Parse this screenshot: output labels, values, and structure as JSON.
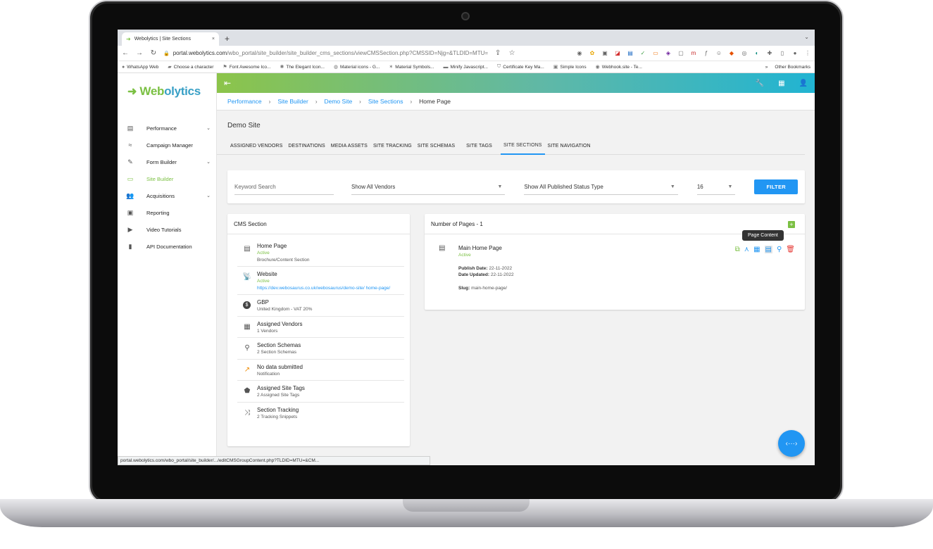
{
  "browser": {
    "tab_title": "Webolytics | Site Sections",
    "tab_close": "×",
    "new_tab": "+",
    "tab_menu": "⌄",
    "url_domain": "portal.webolytics.com",
    "url_path": "/wbo_portal/site_builder/site_builder_cms_sections/viewCMSSection.php?CMSSID=Njg=&TLDID=MTU=",
    "bookmarks": [
      {
        "icon": "whatsapp-icon",
        "label": "WhatsApp Web"
      },
      {
        "icon": "character-icon",
        "label": "Choose a character"
      },
      {
        "icon": "flag-icon",
        "label": "Font Awesome Ico..."
      },
      {
        "icon": "elegant-icon",
        "label": "The Elegant Icon..."
      },
      {
        "icon": "material-icon",
        "label": "Material icons - G..."
      },
      {
        "icon": "symbols-icon",
        "label": "Material Symbols..."
      },
      {
        "icon": "minify-icon",
        "label": "Minify Javascript..."
      },
      {
        "icon": "certificate-icon",
        "label": "Certificate Key Ma..."
      },
      {
        "icon": "simple-icon",
        "label": "Simple Icons"
      },
      {
        "icon": "webhook-icon",
        "label": "Webhook.site - Te..."
      }
    ],
    "bookmarks_more": "»",
    "other_bookmarks": "Other Bookmarks",
    "status_url": "portal.webolytics.com/wbo_portal/site_builder/.../editCMSGroupContent.php?TLDID=MTU=&CM..."
  },
  "app": {
    "brand_prefix": "Web",
    "brand_suffix": "olytics",
    "nav": [
      {
        "icon": "dashboard-icon",
        "label": "Performance",
        "chevron": true
      },
      {
        "icon": "campaign-icon",
        "label": "Campaign Manager",
        "chevron": false
      },
      {
        "icon": "form-icon",
        "label": "Form Builder",
        "chevron": true
      },
      {
        "icon": "site-builder-icon",
        "label": "Site Builder",
        "chevron": false,
        "active": true
      },
      {
        "icon": "people-icon",
        "label": "Acquisitions",
        "chevron": true
      },
      {
        "icon": "report-icon",
        "label": "Reporting",
        "chevron": false
      },
      {
        "icon": "video-icon",
        "label": "Video Tutorials",
        "chevron": false
      },
      {
        "icon": "book-icon",
        "label": "API Documentation",
        "chevron": false
      }
    ],
    "breadcrumb": [
      "Performance",
      "Site Builder",
      "Demo Site",
      "Site Sections",
      "Home Page"
    ],
    "site_title": "Demo Site",
    "tabs": [
      "ASSIGNED VENDORS",
      "DESTINATIONS",
      "MEDIA ASSETS",
      "SITE TRACKING",
      "SITE SCHEMAS",
      "SITE TAGS",
      "SITE SECTIONS",
      "SITE NAVIGATION"
    ],
    "active_tab": "SITE SECTIONS",
    "filters": {
      "keyword_placeholder": "Keyword Search",
      "vendor": "Show All Vendors",
      "status": "Show All Published Status Type",
      "per_page": "16",
      "button": "FILTER"
    },
    "cms_section": {
      "title": "CMS Section",
      "rows": [
        {
          "icon": "page-icon",
          "title": "Home Page",
          "lines": [
            "Active",
            "Brochure/Content Section"
          ]
        },
        {
          "icon": "antenna-icon",
          "title": "Website",
          "lines": [
            "Active",
            "https://dev.webosaurus.co.uk/webosaurus/demo-site/ home-page/"
          ]
        },
        {
          "icon": "currency-icon",
          "title": "GBP",
          "lines": [
            "United Kingdom - VAT 20%"
          ]
        },
        {
          "icon": "building-icon",
          "title": "Assigned Vendors",
          "lines": [
            "1 Vendors"
          ]
        },
        {
          "icon": "search-schema-icon",
          "title": "Section Schemas",
          "lines": [
            "2 Section Schemas"
          ]
        },
        {
          "icon": "notification-icon",
          "title": "No data submitted",
          "lines": [
            "Notification"
          ]
        },
        {
          "icon": "tag-icon",
          "title": "Assigned Site Tags",
          "lines": [
            "2 Assigned Site Tags"
          ]
        },
        {
          "icon": "tracking-icon",
          "title": "Section Tracking",
          "lines": [
            "2 Tracking Snippets"
          ]
        }
      ]
    },
    "pages_card": {
      "title": "Number of Pages - 1",
      "add": "+",
      "page_title": "Main Home Page",
      "page_status": "Active",
      "publish_label": "Publish Date:",
      "publish_date": "22-11-2022",
      "updated_label": "Date Updated:",
      "updated_date": "22-11-2022",
      "slug_label": "Slug:",
      "slug": "main-home-page/",
      "tooltip": "Page Content"
    },
    "fab": "‹···›"
  },
  "colors": {
    "accent_blue": "#2196f3",
    "accent_green": "#7bc043",
    "delete_red": "#e53935"
  }
}
